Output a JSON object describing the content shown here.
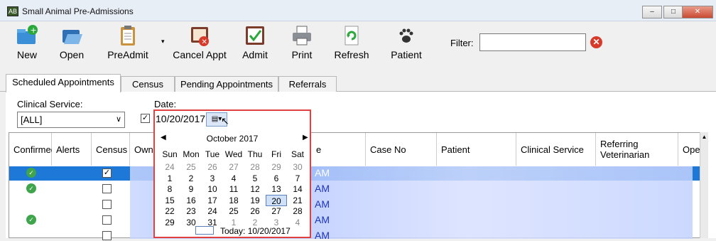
{
  "window": {
    "title": "Small Animal Pre-Admissions",
    "app_icon": "AB"
  },
  "toolbar": {
    "buttons": [
      {
        "label": "New",
        "icon": "folder-add-icon"
      },
      {
        "label": "Open",
        "icon": "folder-open-icon"
      },
      {
        "label": "PreAdmit",
        "icon": "clipboard-icon"
      },
      {
        "label": "Cancel Appt",
        "icon": "cancel-book-icon"
      },
      {
        "label": "Admit",
        "icon": "admit-check-icon"
      },
      {
        "label": "Print",
        "icon": "printer-icon"
      },
      {
        "label": "Refresh",
        "icon": "refresh-icon"
      },
      {
        "label": "Patient",
        "icon": "paw-icon"
      }
    ],
    "filter_label": "Filter:",
    "filter_value": ""
  },
  "tabs": [
    {
      "label": "Scheduled Appointments",
      "active": true
    },
    {
      "label": "Census",
      "active": false
    },
    {
      "label": "Pending Appointments",
      "active": false
    },
    {
      "label": "Referrals",
      "active": false
    }
  ],
  "filters": {
    "clinical_service_label": "Clinical Service:",
    "clinical_service_value": "[ALL]",
    "date_label": "Date:",
    "date_value": "10/20/2017",
    "date_enabled": true
  },
  "grid": {
    "columns": [
      "Confirmed",
      "Alerts",
      "Census",
      "Own",
      "e",
      "Case No",
      "Patient",
      "Clinical Service",
      "Referring Veterinarian",
      "Oper"
    ],
    "rows": [
      {
        "confirmed": true,
        "census": true,
        "time": "AM"
      },
      {
        "confirmed": true,
        "census": false,
        "time": "AM"
      },
      {
        "confirmed": false,
        "census": false,
        "time": "AM"
      },
      {
        "confirmed": true,
        "census": false,
        "time": "AM"
      },
      {
        "confirmed": false,
        "census": false,
        "time": "AM"
      }
    ]
  },
  "calendar": {
    "month_label": "October 2017",
    "weekdays": [
      "Sun",
      "Mon",
      "Tue",
      "Wed",
      "Thu",
      "Fri",
      "Sat"
    ],
    "weeks": [
      [
        "24",
        "25",
        "26",
        "27",
        "28",
        "29",
        "30"
      ],
      [
        "1",
        "2",
        "3",
        "4",
        "5",
        "6",
        "7"
      ],
      [
        "8",
        "9",
        "10",
        "11",
        "12",
        "13",
        "14"
      ],
      [
        "15",
        "16",
        "17",
        "18",
        "19",
        "20",
        "21"
      ],
      [
        "22",
        "23",
        "24",
        "25",
        "26",
        "27",
        "28"
      ],
      [
        "29",
        "30",
        "31",
        "1",
        "2",
        "3",
        "4"
      ]
    ],
    "selected": "20",
    "today_label": "Today: 10/20/2017"
  }
}
